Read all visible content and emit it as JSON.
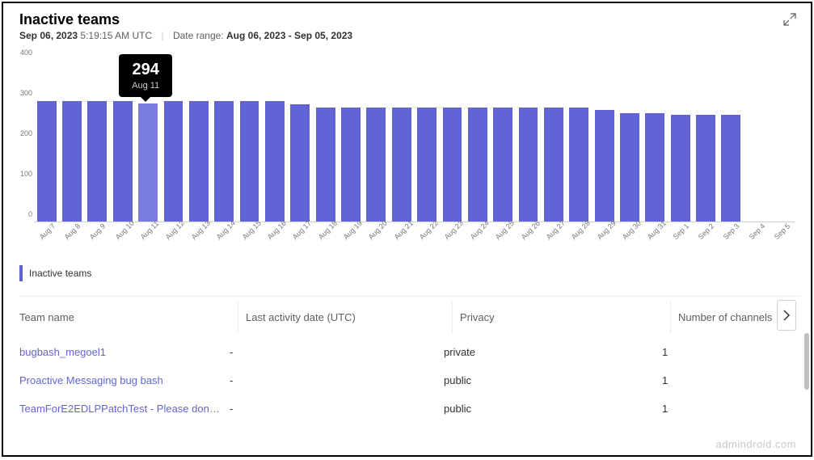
{
  "header": {
    "title": "Inactive teams",
    "date": "Sep 06, 2023",
    "time": "5:19:15 AM UTC",
    "date_range_label": "Date range:",
    "date_range_value": "Aug 06, 2023 - Sep 05, 2023"
  },
  "chart_data": {
    "type": "bar",
    "title": "Inactive teams",
    "ylabel": "",
    "xlabel": "",
    "ylim": [
      0,
      400
    ],
    "yticks": [
      0,
      100,
      200,
      300,
      400
    ],
    "categories": [
      "Aug 7",
      "Aug 8",
      "Aug 9",
      "Aug 10",
      "Aug 11",
      "Aug 12",
      "Aug 13",
      "Aug 14",
      "Aug 15",
      "Aug 16",
      "Aug 17",
      "Aug 18",
      "Aug 19",
      "Aug 20",
      "Aug 21",
      "Aug 22",
      "Aug 23",
      "Aug 24",
      "Aug 25",
      "Aug 26",
      "Aug 27",
      "Aug 28",
      "Aug 29",
      "Aug 30",
      "Aug 31",
      "Sep 1",
      "Sep 2",
      "Sep 3",
      "Sep 4",
      "Sep 5"
    ],
    "values": [
      300,
      300,
      300,
      300,
      294,
      300,
      300,
      300,
      300,
      300,
      292,
      283,
      283,
      283,
      283,
      283,
      283,
      283,
      283,
      283,
      283,
      283,
      278,
      270,
      270,
      265,
      265,
      265,
      null,
      null
    ],
    "tooltip": {
      "index": 4,
      "value": "294",
      "label": "Aug 11"
    }
  },
  "legend": {
    "label": "Inactive teams"
  },
  "table": {
    "columns": [
      "Team name",
      "Last activity date (UTC)",
      "Privacy",
      "Number of channels"
    ],
    "rows": [
      {
        "team": "bugbash_megoel1",
        "date": "-",
        "privacy": "private",
        "channels": "1"
      },
      {
        "team": "Proactive Messaging bug bash",
        "date": "-",
        "privacy": "public",
        "channels": "1"
      },
      {
        "team": "TeamForE2EDLPPatchTest - Please don't ...",
        "date": "-",
        "privacy": "public",
        "channels": "1"
      }
    ]
  },
  "watermark": "admindroid.com"
}
